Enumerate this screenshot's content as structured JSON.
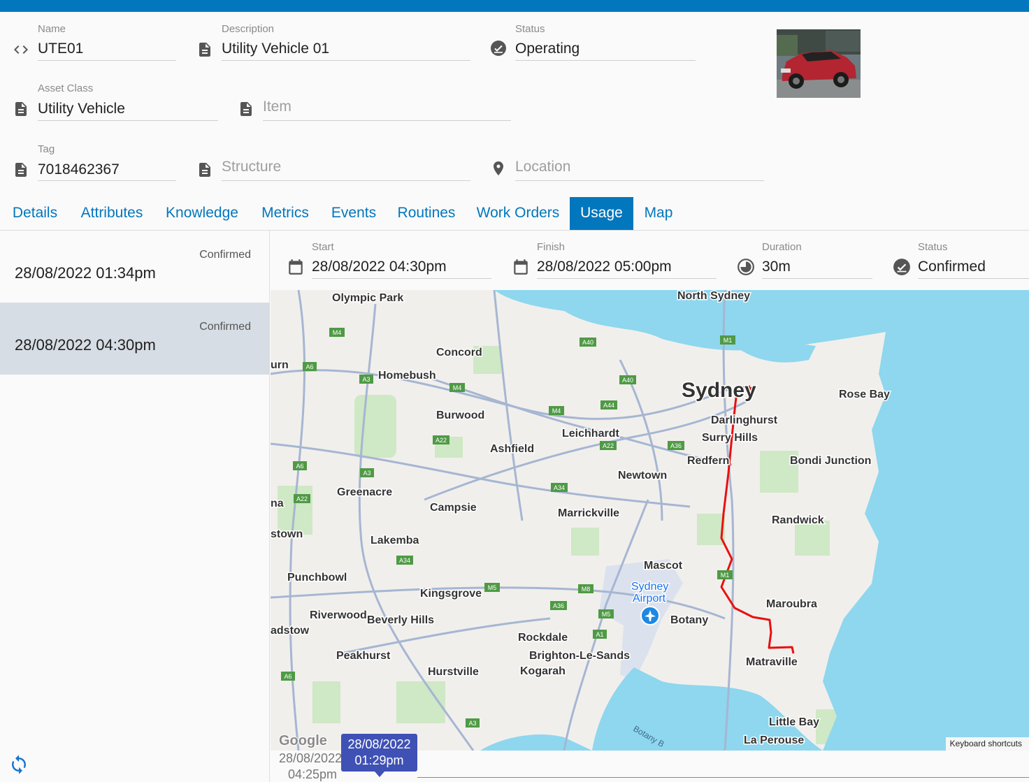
{
  "asset": {
    "name": {
      "label": "Name",
      "value": "UTE01"
    },
    "description": {
      "label": "Description",
      "value": "Utility Vehicle 01"
    },
    "status": {
      "label": "Status",
      "value": "Operating"
    },
    "asset_class": {
      "label": "Asset Class",
      "value": "Utility Vehicle"
    },
    "item": {
      "placeholder": "Item"
    },
    "tag": {
      "label": "Tag",
      "value": "7018462367"
    },
    "structure": {
      "placeholder": "Structure"
    },
    "location": {
      "placeholder": "Location"
    }
  },
  "tabs": [
    {
      "label": "Details"
    },
    {
      "label": "Attributes"
    },
    {
      "label": "Knowledge"
    },
    {
      "label": "Metrics"
    },
    {
      "label": "Events"
    },
    {
      "label": "Routines"
    },
    {
      "label": "Work Orders"
    },
    {
      "label": "Usage",
      "active": true
    },
    {
      "label": "Map"
    }
  ],
  "usage_list": [
    {
      "status": "Confirmed",
      "date": "28/08/2022 01:34pm"
    },
    {
      "status": "Confirmed",
      "date": "28/08/2022 04:30pm",
      "selected": true
    }
  ],
  "detail": {
    "start": {
      "label": "Start",
      "value": "28/08/2022 04:30pm"
    },
    "finish": {
      "label": "Finish",
      "value": "28/08/2022 05:00pm"
    },
    "duration": {
      "label": "Duration",
      "value": "30m"
    },
    "status": {
      "label": "Status",
      "value": "Confirmed"
    }
  },
  "map": {
    "labels": {
      "olympic_park": "Olympic Park",
      "north_sydney": "North Sydney",
      "concord": "Concord",
      "homebush": "Homebush",
      "sydney": "Sydney",
      "rose_bay": "Rose Bay",
      "burwood": "Burwood",
      "darlinghurst": "Darlinghurst",
      "surry_hills": "Surry Hills",
      "leichhardt": "Leichhardt",
      "ashfield": "Ashfield",
      "redfern": "Redfern",
      "bondi_junction": "Bondi Junction",
      "newtown": "Newtown",
      "greenacre": "Greenacre",
      "campsie": "Campsie",
      "marrickville": "Marrickville",
      "randwick": "Randwick",
      "lakemba": "Lakemba",
      "mascot": "Mascot",
      "punchbowl": "Punchbowl",
      "sydney_airport_1": "Sydney",
      "sydney_airport_2": "Airport",
      "kingsgrove": "Kingsgrove",
      "maroubra": "Maroubra",
      "riverwood": "Riverwood",
      "beverly_hills": "Beverly Hills",
      "botany": "Botany",
      "rockdale": "Rockdale",
      "brighton": "Brighton-Le-Sands",
      "peakhurst": "Peakhurst",
      "matraville": "Matraville",
      "hurstville": "Hurstville",
      "kogarah": "Kogarah",
      "little_bay": "Little Bay",
      "la_perouse": "La Perouse",
      "edge_urn": "urn",
      "edge_na": "na",
      "edge_stown": "stown",
      "edge_adstow": "adstow",
      "botany_bay": "Botany B",
      "google": "Google"
    },
    "shields": [
      "M4",
      "A6",
      "A3",
      "M4",
      "A40",
      "A40",
      "M1",
      "A44",
      "M4",
      "A22",
      "A22",
      "A36",
      "A6",
      "A3",
      "A22",
      "A34",
      "A34",
      "M5",
      "M8",
      "A36",
      "M5",
      "A1",
      "A6",
      "A3",
      "M1"
    ],
    "keyboard_shortcuts": "Keyboard shortcuts",
    "route_color": "#e81010",
    "water_color": "#8ed7ee"
  },
  "timeline": {
    "ghost_line1": "28/08/2022",
    "ghost_line2": "04:25pm",
    "bubble_line1": "28/08/2022",
    "bubble_line2": "01:29pm"
  },
  "colors": {
    "accent": "#0277bd",
    "bubble": "#3f51b5",
    "selected_row": "#d7dde4"
  }
}
